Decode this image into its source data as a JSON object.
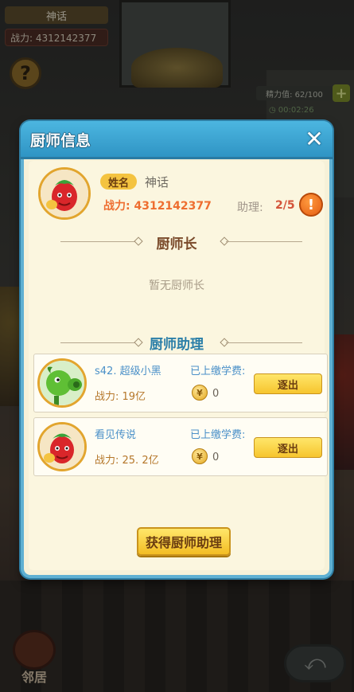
{
  "hud": {
    "player_name": "神话",
    "power_text": "战力: 4312142377",
    "help_symbol": "?",
    "energy_text": "精力值: 62/100",
    "energy_plus": "+",
    "timer_text": "00:02:26",
    "neighbor_label": "邻居"
  },
  "dialog": {
    "title": "厨师信息",
    "close_symbol": "✕",
    "profile": {
      "name_tag": "姓名",
      "name": "神话",
      "power": "战力: 4312142377",
      "assist_label": "助理: ",
      "assist_count": "2/5",
      "alert_symbol": "!"
    },
    "head_chef_title": "厨师长",
    "head_chef_empty": "暂无厨师长",
    "assistants_title": "厨师助理",
    "assistants": [
      {
        "name": "s42. 超级小黑",
        "power": "战力: 19亿",
        "fee_label": "已上缴学费:",
        "fee": "0",
        "kick_label": "逐出",
        "avatar": "peashooter"
      },
      {
        "name": "看见传说",
        "power": "战力: 25. 2亿",
        "fee_label": "已上缴学费:",
        "fee": "0",
        "kick_label": "逐出",
        "avatar": "pepper-chef"
      }
    ],
    "get_assistant_label": "获得厨师助理"
  },
  "colors": {
    "header_blue": "#2f94c4",
    "panel_cream": "#fbf6df",
    "power_orange": "#ee6e30",
    "button_yellow": "#f6c52e",
    "link_blue": "#4a90c8"
  }
}
